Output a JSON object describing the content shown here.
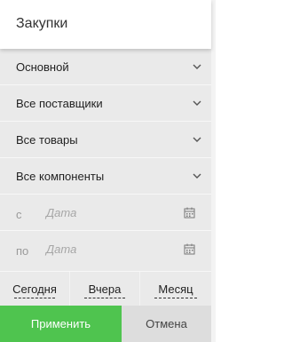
{
  "header": {
    "title": "Закупки"
  },
  "filters": [
    {
      "label": "Основной"
    },
    {
      "label": "Все поставщики"
    },
    {
      "label": "Все товары"
    },
    {
      "label": "Все компоненты"
    }
  ],
  "date_from": {
    "prefix": "с",
    "placeholder": "Дата"
  },
  "date_to": {
    "prefix": "по",
    "placeholder": "Дата"
  },
  "quick_ranges": [
    {
      "label": "Сегодня"
    },
    {
      "label": "Вчера"
    },
    {
      "label": "Месяц"
    }
  ],
  "actions": {
    "apply": "Применить",
    "cancel": "Отмена"
  },
  "colors": {
    "apply_bg": "#4fc44f",
    "panel_bg": "#eaeaea"
  },
  "icons": {
    "dropdown": "chevron-down-icon",
    "calendar": "calendar-icon"
  }
}
